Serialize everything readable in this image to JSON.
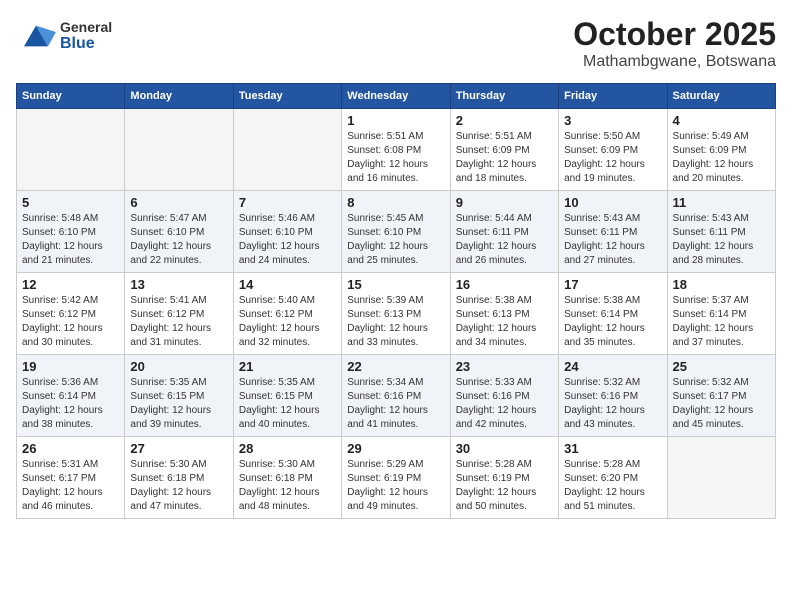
{
  "header": {
    "logo_general": "General",
    "logo_blue": "Blue",
    "month": "October 2025",
    "location": "Mathambgwane, Botswana"
  },
  "days_of_week": [
    "Sunday",
    "Monday",
    "Tuesday",
    "Wednesday",
    "Thursday",
    "Friday",
    "Saturday"
  ],
  "weeks": [
    [
      {
        "day": "",
        "empty": true
      },
      {
        "day": "",
        "empty": true
      },
      {
        "day": "",
        "empty": true
      },
      {
        "day": "1",
        "sunrise": "5:51 AM",
        "sunset": "6:08 PM",
        "daylight": "12 hours and 16 minutes."
      },
      {
        "day": "2",
        "sunrise": "5:51 AM",
        "sunset": "6:09 PM",
        "daylight": "12 hours and 18 minutes."
      },
      {
        "day": "3",
        "sunrise": "5:50 AM",
        "sunset": "6:09 PM",
        "daylight": "12 hours and 19 minutes."
      },
      {
        "day": "4",
        "sunrise": "5:49 AM",
        "sunset": "6:09 PM",
        "daylight": "12 hours and 20 minutes."
      }
    ],
    [
      {
        "day": "5",
        "sunrise": "5:48 AM",
        "sunset": "6:10 PM",
        "daylight": "12 hours and 21 minutes."
      },
      {
        "day": "6",
        "sunrise": "5:47 AM",
        "sunset": "6:10 PM",
        "daylight": "12 hours and 22 minutes."
      },
      {
        "day": "7",
        "sunrise": "5:46 AM",
        "sunset": "6:10 PM",
        "daylight": "12 hours and 24 minutes."
      },
      {
        "day": "8",
        "sunrise": "5:45 AM",
        "sunset": "6:10 PM",
        "daylight": "12 hours and 25 minutes."
      },
      {
        "day": "9",
        "sunrise": "5:44 AM",
        "sunset": "6:11 PM",
        "daylight": "12 hours and 26 minutes."
      },
      {
        "day": "10",
        "sunrise": "5:43 AM",
        "sunset": "6:11 PM",
        "daylight": "12 hours and 27 minutes."
      },
      {
        "day": "11",
        "sunrise": "5:43 AM",
        "sunset": "6:11 PM",
        "daylight": "12 hours and 28 minutes."
      }
    ],
    [
      {
        "day": "12",
        "sunrise": "5:42 AM",
        "sunset": "6:12 PM",
        "daylight": "12 hours and 30 minutes."
      },
      {
        "day": "13",
        "sunrise": "5:41 AM",
        "sunset": "6:12 PM",
        "daylight": "12 hours and 31 minutes."
      },
      {
        "day": "14",
        "sunrise": "5:40 AM",
        "sunset": "6:12 PM",
        "daylight": "12 hours and 32 minutes."
      },
      {
        "day": "15",
        "sunrise": "5:39 AM",
        "sunset": "6:13 PM",
        "daylight": "12 hours and 33 minutes."
      },
      {
        "day": "16",
        "sunrise": "5:38 AM",
        "sunset": "6:13 PM",
        "daylight": "12 hours and 34 minutes."
      },
      {
        "day": "17",
        "sunrise": "5:38 AM",
        "sunset": "6:14 PM",
        "daylight": "12 hours and 35 minutes."
      },
      {
        "day": "18",
        "sunrise": "5:37 AM",
        "sunset": "6:14 PM",
        "daylight": "12 hours and 37 minutes."
      }
    ],
    [
      {
        "day": "19",
        "sunrise": "5:36 AM",
        "sunset": "6:14 PM",
        "daylight": "12 hours and 38 minutes."
      },
      {
        "day": "20",
        "sunrise": "5:35 AM",
        "sunset": "6:15 PM",
        "daylight": "12 hours and 39 minutes."
      },
      {
        "day": "21",
        "sunrise": "5:35 AM",
        "sunset": "6:15 PM",
        "daylight": "12 hours and 40 minutes."
      },
      {
        "day": "22",
        "sunrise": "5:34 AM",
        "sunset": "6:16 PM",
        "daylight": "12 hours and 41 minutes."
      },
      {
        "day": "23",
        "sunrise": "5:33 AM",
        "sunset": "6:16 PM",
        "daylight": "12 hours and 42 minutes."
      },
      {
        "day": "24",
        "sunrise": "5:32 AM",
        "sunset": "6:16 PM",
        "daylight": "12 hours and 43 minutes."
      },
      {
        "day": "25",
        "sunrise": "5:32 AM",
        "sunset": "6:17 PM",
        "daylight": "12 hours and 45 minutes."
      }
    ],
    [
      {
        "day": "26",
        "sunrise": "5:31 AM",
        "sunset": "6:17 PM",
        "daylight": "12 hours and 46 minutes."
      },
      {
        "day": "27",
        "sunrise": "5:30 AM",
        "sunset": "6:18 PM",
        "daylight": "12 hours and 47 minutes."
      },
      {
        "day": "28",
        "sunrise": "5:30 AM",
        "sunset": "6:18 PM",
        "daylight": "12 hours and 48 minutes."
      },
      {
        "day": "29",
        "sunrise": "5:29 AM",
        "sunset": "6:19 PM",
        "daylight": "12 hours and 49 minutes."
      },
      {
        "day": "30",
        "sunrise": "5:28 AM",
        "sunset": "6:19 PM",
        "daylight": "12 hours and 50 minutes."
      },
      {
        "day": "31",
        "sunrise": "5:28 AM",
        "sunset": "6:20 PM",
        "daylight": "12 hours and 51 minutes."
      },
      {
        "day": "",
        "empty": true
      }
    ]
  ],
  "labels": {
    "sunrise": "Sunrise:",
    "sunset": "Sunset:",
    "daylight": "Daylight:"
  }
}
